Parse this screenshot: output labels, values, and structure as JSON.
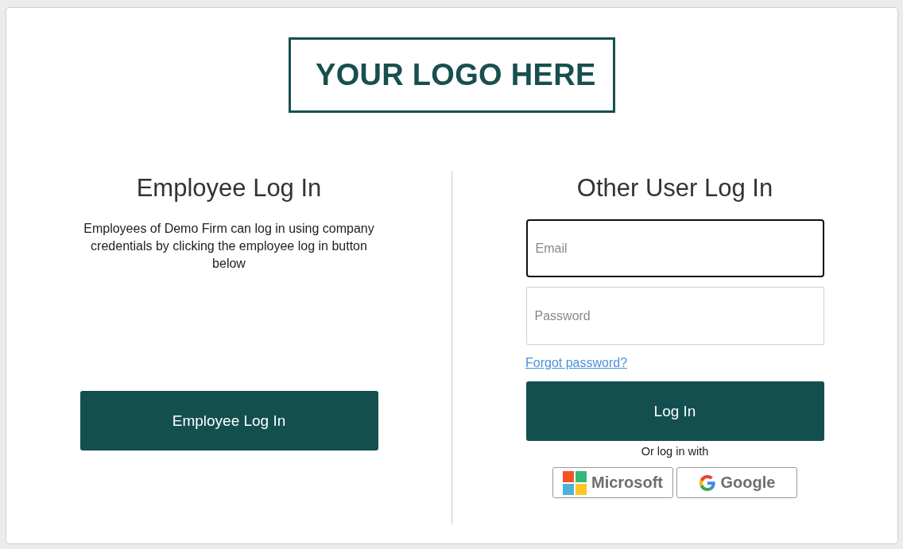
{
  "logo": {
    "text": "YOUR LOGO HERE"
  },
  "employee": {
    "title": "Employee Log In",
    "description": "Employees of Demo Firm can log in using company credentials by clicking the employee log in button below",
    "button": "Employee Log In"
  },
  "other": {
    "title": "Other User Log In",
    "fields": [
      {
        "placeholder": "Email",
        "focused": true
      },
      {
        "placeholder": "Password",
        "focused": false
      }
    ],
    "forgot_link": "Forgot password?",
    "button": "Log In",
    "alt_label": "Or log in with",
    "providers": [
      {
        "label": "Microsoft",
        "kind": "microsoft"
      },
      {
        "label": "Google",
        "kind": "google"
      }
    ]
  }
}
